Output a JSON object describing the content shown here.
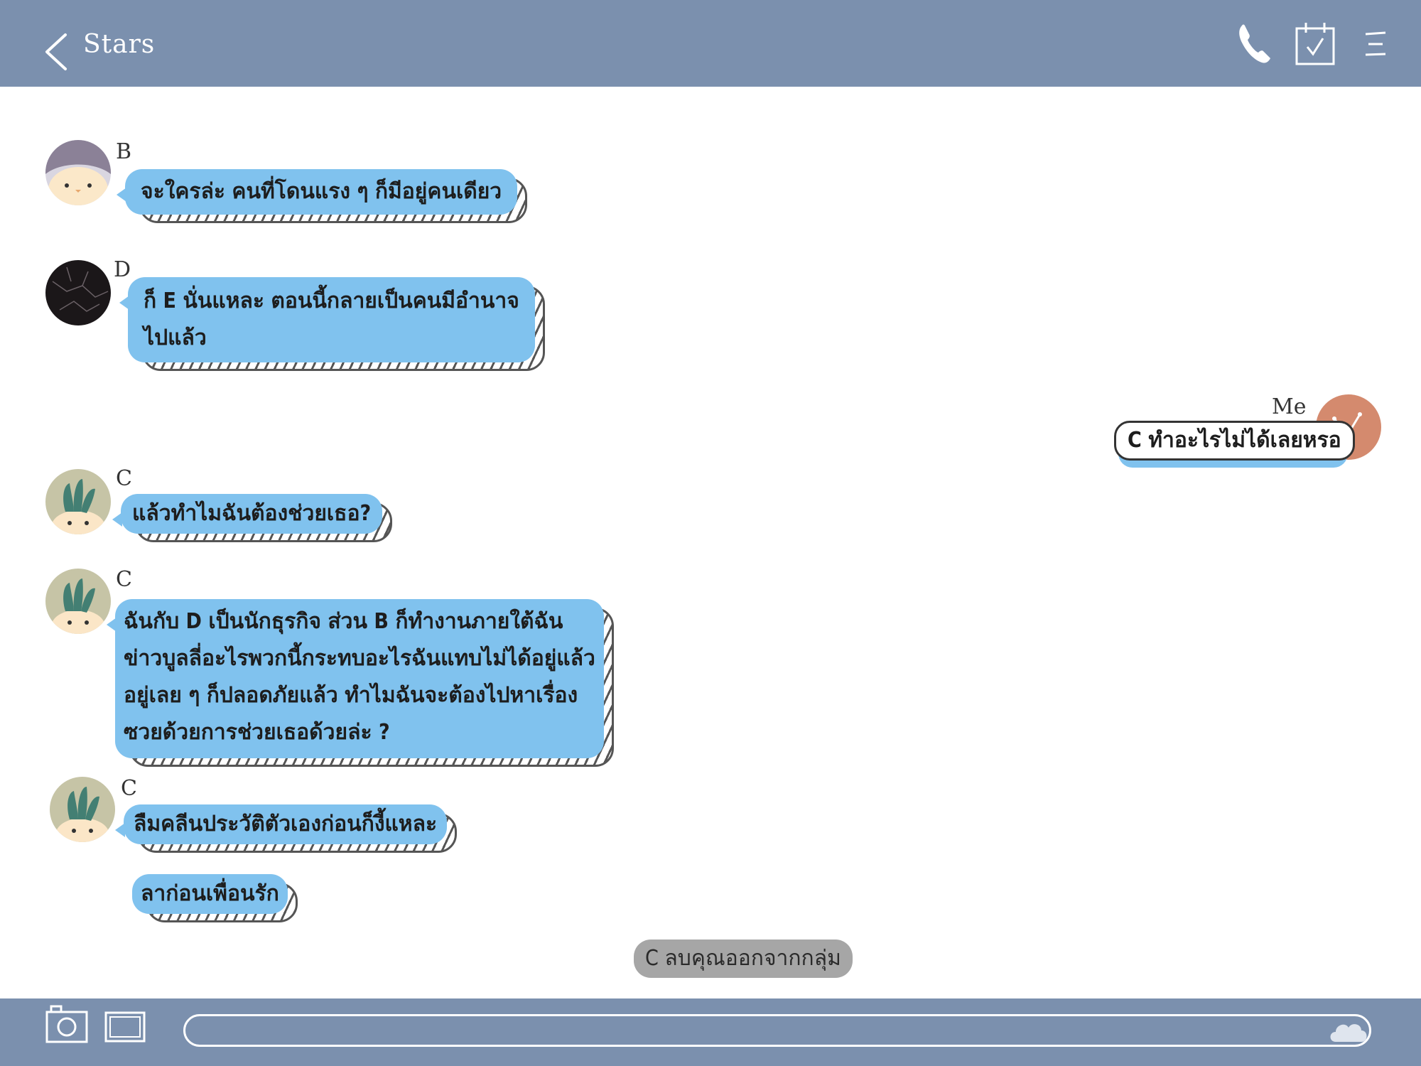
{
  "header": {
    "title": "Stars"
  },
  "messages": [
    {
      "sender": "B",
      "text": [
        "จะใครล่ะ คนที่โดนแรง ๆ ก็มีอยู่คนเดียว"
      ]
    },
    {
      "sender": "D",
      "text": [
        "ก็ E นั่นแหละ ตอนนี้กลายเป็นคนมีอำนาจ",
        "ไปแล้ว"
      ]
    },
    {
      "sender": "Me",
      "text": [
        "C ทำอะไรไม่ได้เลยหรอ"
      ]
    },
    {
      "sender": "C",
      "text": [
        "แล้วทำไมฉันต้องช่วยเธอ?"
      ]
    },
    {
      "sender": "C",
      "text": [
        "ฉันกับ D เป็นนักธุรกิจ ส่วน B ก็ทำงานภายใต้ฉัน",
        "ข่าวบูลลี่อะไรพวกนี้กระทบอะไรฉันแทบไม่ได้อยู่แล้ว",
        "อยู่เลย ๆ ก็ปลอดภัยแล้ว ทำไมฉันจะต้องไปหาเรื่อง",
        "ซวยด้วยการช่วยเธอด้วยล่ะ ?"
      ]
    },
    {
      "sender": "C",
      "text": [
        "ลืมคลีนประวัติตัวเองก่อนก็งี้แหละ"
      ]
    },
    {
      "sender": "",
      "text": [
        "ลาก่อนเพื่อนรัก"
      ]
    }
  ],
  "system_message": "C ลบคุณออกจากกลุ่ม",
  "composer": {
    "value": "",
    "placeholder": ""
  },
  "colors": {
    "bar": "#7b90ae",
    "bubble": "#80c2ee",
    "system_pill": "#a6a6a6"
  },
  "icons": {
    "back": "chevron-left-icon",
    "call": "phone-icon",
    "notes": "calendar-check-icon",
    "menu": "hamburger-menu-icon",
    "camera": "camera-icon",
    "gallery": "image-icon",
    "send": "cloud-icon"
  }
}
